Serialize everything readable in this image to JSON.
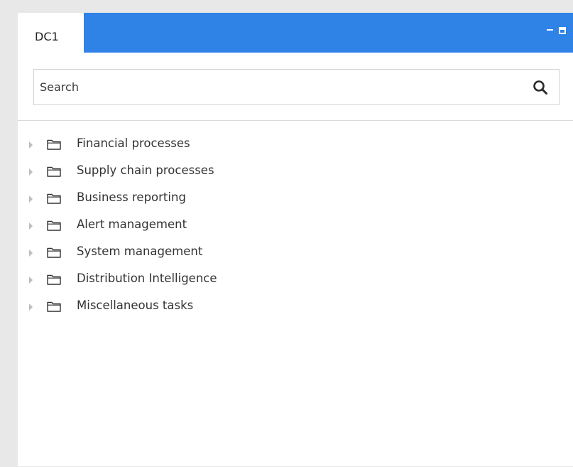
{
  "panel": {
    "tab_label": "DC1",
    "accent_color": "#2f83e6"
  },
  "window_controls": {
    "minimize_icon": "minimize-icon",
    "maximize_icon": "maximize-icon"
  },
  "search": {
    "placeholder": "Search",
    "value": "",
    "icon": "search-icon"
  },
  "tree": {
    "items": [
      {
        "label": "Financial processes",
        "icon": "folder-icon",
        "expanded": false
      },
      {
        "label": "Supply chain processes",
        "icon": "folder-icon",
        "expanded": false
      },
      {
        "label": "Business reporting",
        "icon": "folder-icon",
        "expanded": false
      },
      {
        "label": "Alert management",
        "icon": "folder-icon",
        "expanded": false
      },
      {
        "label": "System management",
        "icon": "folder-icon",
        "expanded": false
      },
      {
        "label": "Distribution Intelligence",
        "icon": "folder-icon",
        "expanded": false
      },
      {
        "label": "Miscellaneous tasks",
        "icon": "folder-icon",
        "expanded": false
      }
    ]
  }
}
